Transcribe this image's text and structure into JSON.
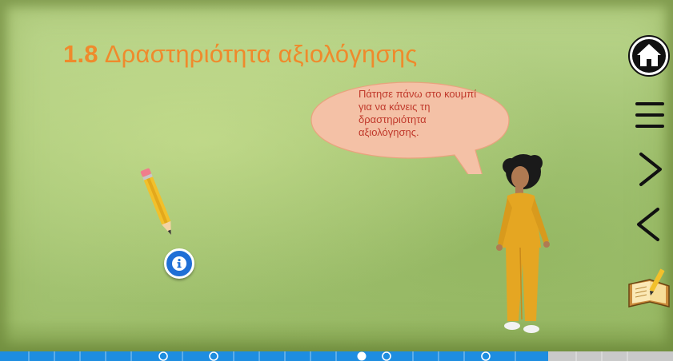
{
  "lesson": {
    "number": "1.8",
    "title": "Δραστηριότητα αξιολόγησης"
  },
  "speech_bubble": {
    "text": "Πάτησε πάνω στο κουμπί για να κάνεις τη δραστηριότητα αξιολόγησης."
  },
  "icons": {
    "pencil": "pencil-icon",
    "info": "info-icon",
    "home": "home-icon",
    "menu": "menu-icon",
    "next": "chevron-right-icon",
    "previous": "chevron-left-icon",
    "activity_book": "notebook-icon",
    "character": "teacher-character"
  },
  "progress": {
    "completed_fraction": 0.815,
    "markers": [
      "circle",
      "circle",
      "filled",
      "circle",
      "circle"
    ]
  },
  "colors": {
    "title": "#ef8a2c",
    "bubble_fill": "#f4c1a6",
    "bubble_text": "#c0392b",
    "info_button": "#1f6fd6",
    "progress_fill": "#1e8de0",
    "progress_track": "#c9c9c9"
  }
}
